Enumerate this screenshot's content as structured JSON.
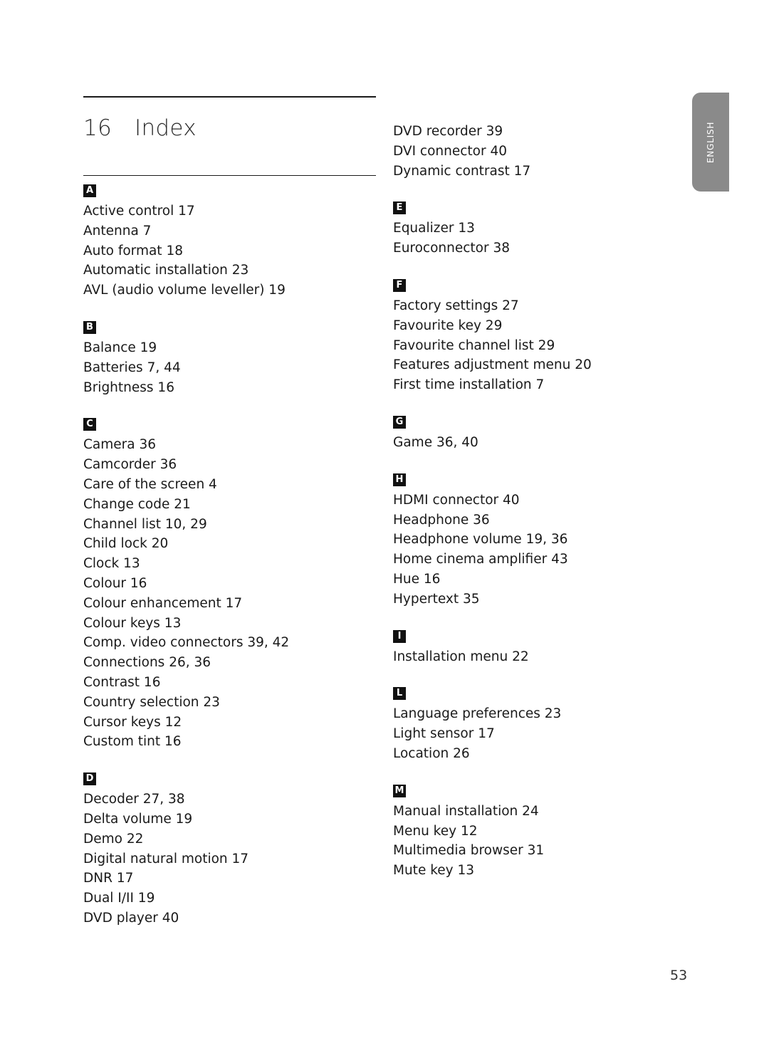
{
  "chapter": {
    "number": "16",
    "title": "Index"
  },
  "language_tab": "ENGLISH",
  "page_number": "53",
  "left_column": [
    {
      "letter": "A",
      "entries": [
        "Active control 17",
        "Antenna 7",
        "Auto format 18",
        "Automatic installation 23",
        "AVL (audio volume leveller) 19"
      ]
    },
    {
      "letter": "B",
      "entries": [
        "Balance 19",
        "Batteries 7, 44",
        "Brightness  16"
      ]
    },
    {
      "letter": "C",
      "entries": [
        "Camera 36",
        "Camcorder 36",
        "Care of the screen 4",
        "Change code 21",
        "Channel list 10, 29",
        "Child lock 20",
        "Clock 13",
        "Colour 16",
        "Colour enhancement 17",
        "Colour keys 13",
        "Comp. video connectors 39, 42",
        "Connections 26, 36",
        "Contrast 16",
        "Country selection 23",
        "Cursor keys 12",
        "Custom tint 16"
      ]
    },
    {
      "letter": "D",
      "entries": [
        "Decoder 27, 38",
        "Delta volume 19",
        "Demo 22",
        "Digital natural motion 17",
        "DNR 17",
        "Dual I/II 19",
        "DVD player 40"
      ]
    }
  ],
  "right_column": [
    {
      "letter": "",
      "entries": [
        "DVD recorder 39",
        "DVI connector 40",
        "Dynamic contrast 17"
      ]
    },
    {
      "letter": "E",
      "entries": [
        "Equalizer 13",
        "Euroconnector 38"
      ]
    },
    {
      "letter": "F",
      "entries": [
        "Factory settings 27",
        "Favourite key 29",
        "Favourite channel list 29",
        "Features adjustment menu 20",
        "First time installation 7"
      ]
    },
    {
      "letter": "G",
      "entries": [
        "Game 36, 40"
      ]
    },
    {
      "letter": "H",
      "entries": [
        "HDMI connector 40",
        "Headphone 36",
        "Headphone volume 19, 36",
        "Home cinema amplifier 43",
        "Hue 16",
        "Hypertext 35"
      ]
    },
    {
      "letter": "I",
      "entries": [
        "Installation menu 22"
      ]
    },
    {
      "letter": "L",
      "entries": [
        "Language preferences 23",
        "Light sensor 17",
        "Location 26"
      ]
    },
    {
      "letter": "M",
      "entries": [
        "Manual installation 24",
        "Menu key 12",
        "Multimedia browser 31",
        "Mute key 13"
      ]
    }
  ]
}
